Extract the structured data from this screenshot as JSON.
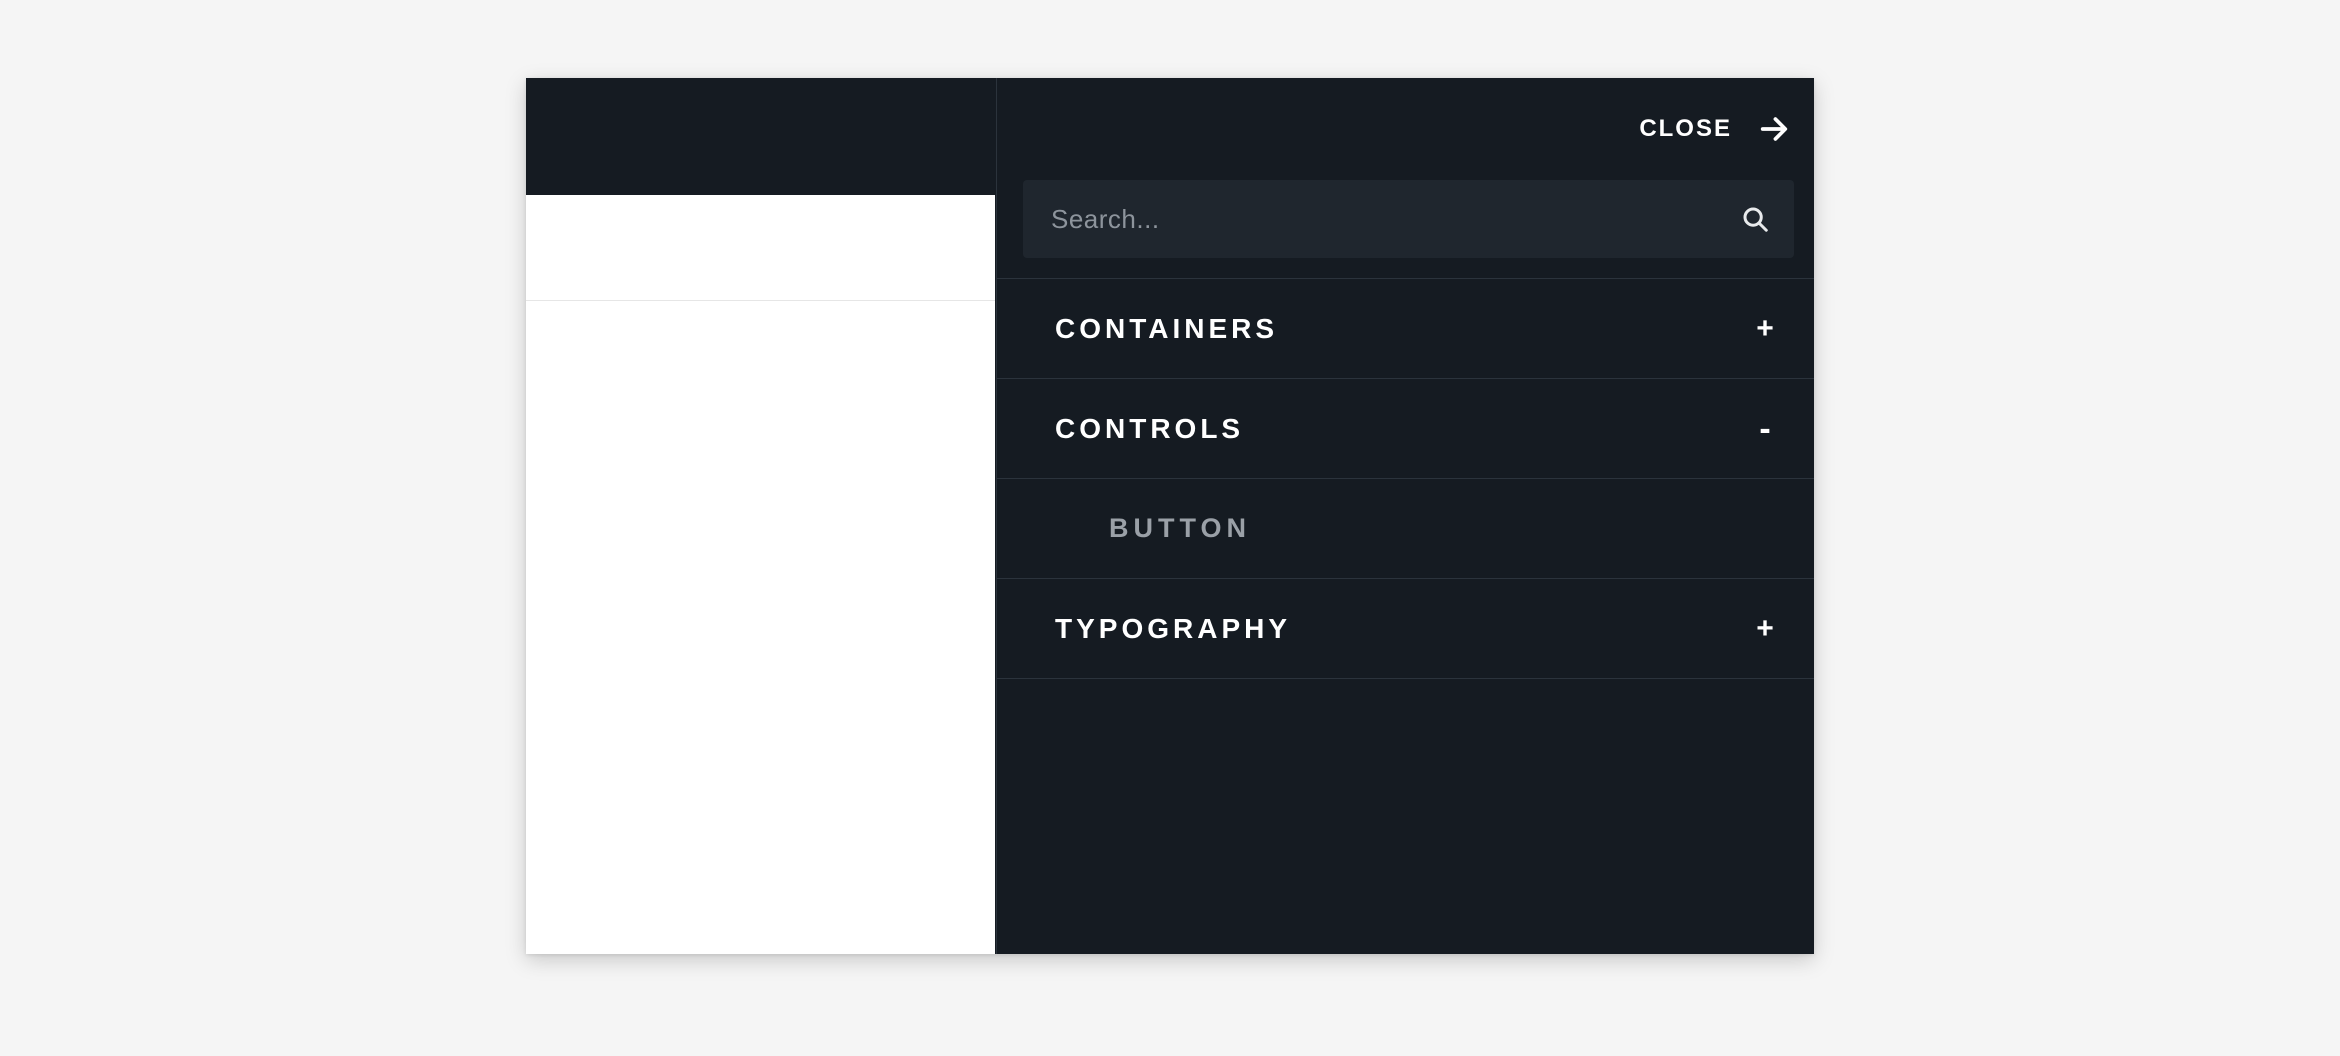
{
  "close": {
    "label": "CLOSE"
  },
  "search": {
    "placeholder": "Search...",
    "value": ""
  },
  "categories": [
    {
      "label": "CONTAINERS",
      "expanded": false,
      "toggle": "+"
    },
    {
      "label": "CONTROLS",
      "expanded": true,
      "toggle": "-",
      "items": [
        {
          "label": "BUTTON"
        }
      ]
    },
    {
      "label": "TYPOGRAPHY",
      "expanded": false,
      "toggle": "+"
    }
  ]
}
